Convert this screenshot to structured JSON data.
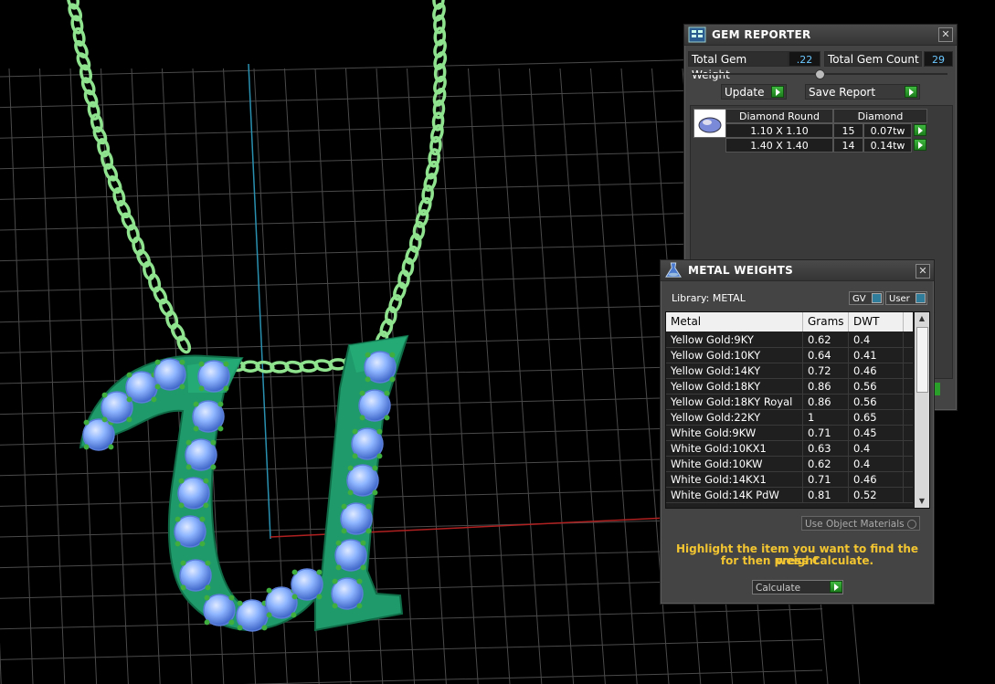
{
  "gem_reporter": {
    "title": "GEM REPORTER",
    "close_icon": "close-icon",
    "total_gem_weight_label": "Total Gem Weight",
    "total_gem_weight_value": ".22",
    "total_gem_count_label": "Total Gem Count",
    "total_gem_count_value": "29",
    "update_label": "Update",
    "save_report_label": "Save Report",
    "gem_shape_header": "Diamond Round",
    "gem_type_header": "Diamond",
    "gems": [
      {
        "size": "1.10 X 1.10",
        "count": "15",
        "weight": "0.07tw"
      },
      {
        "size": "1.40 X 1.40",
        "count": "14",
        "weight": "0.14tw"
      }
    ]
  },
  "metal_weights": {
    "title": "METAL WEIGHTS",
    "library_label": "Library: METAL",
    "gv_label": "GV",
    "user_label": "User",
    "columns": [
      "Metal",
      "Grams",
      "DWT"
    ],
    "rows": [
      {
        "metal": "Yellow Gold:9KY",
        "grams": "0.62",
        "dwt": "0.4"
      },
      {
        "metal": "Yellow Gold:10KY",
        "grams": "0.64",
        "dwt": "0.41"
      },
      {
        "metal": "Yellow Gold:14KY",
        "grams": "0.72",
        "dwt": "0.46"
      },
      {
        "metal": "Yellow Gold:18KY",
        "grams": "0.86",
        "dwt": "0.56"
      },
      {
        "metal": "Yellow Gold:18KY Royal",
        "grams": "0.86",
        "dwt": "0.56"
      },
      {
        "metal": "Yellow Gold:22KY",
        "grams": "1",
        "dwt": "0.65"
      },
      {
        "metal": "White Gold:9KW",
        "grams": "0.71",
        "dwt": "0.45"
      },
      {
        "metal": "White Gold:10KX1",
        "grams": "0.63",
        "dwt": "0.4"
      },
      {
        "metal": "White Gold:10KW",
        "grams": "0.62",
        "dwt": "0.4"
      },
      {
        "metal": "White Gold:14KX1",
        "grams": "0.71",
        "dwt": "0.46"
      },
      {
        "metal": "White Gold:14K PdW",
        "grams": "0.81",
        "dwt": "0.52"
      }
    ],
    "use_object_materials_label": "Use Object Materials",
    "hint_line1": "Highlight the item you want to find the weight",
    "hint_line2": "for then press Calculate.",
    "calculate_label": "Calculate"
  },
  "colors": {
    "viewport_bg": "#000000",
    "grid": "#4a4a4a",
    "pendant_green": "#1f9a6a",
    "chain_green": "#8fe38f",
    "gem_blue": "#8fb6ff",
    "hint_yellow": "#f2c531",
    "value_blue": "#6cc8ff"
  }
}
